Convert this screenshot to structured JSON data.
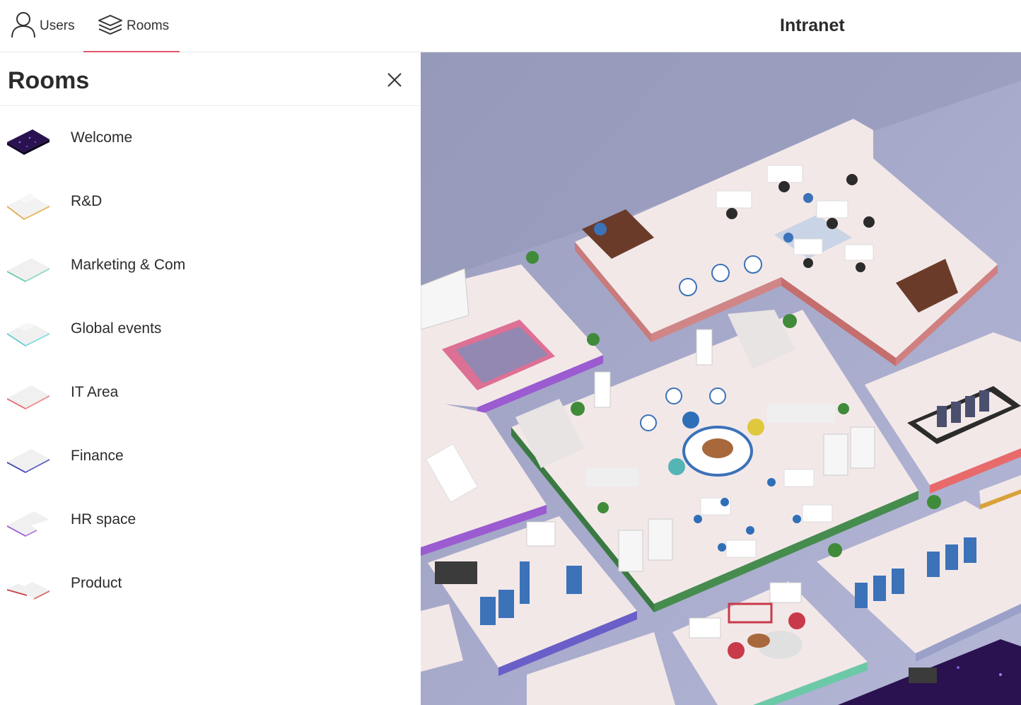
{
  "topbar": {
    "tabs": [
      {
        "label": "Users",
        "icon": "user-icon"
      },
      {
        "label": "Rooms",
        "icon": "layers-icon",
        "active": true
      }
    ],
    "title": "Intranet",
    "accent_color": "#e3566b"
  },
  "panel": {
    "title": "Rooms",
    "close_icon": "close-icon",
    "rooms": [
      {
        "name": "Welcome",
        "edge_color": "#1b0b3a"
      },
      {
        "name": "R&D",
        "edge_color": "#e0a23a"
      },
      {
        "name": "Marketing & Com",
        "edge_color": "#6cc9a8"
      },
      {
        "name": "Global events",
        "edge_color": "#5fc9d0"
      },
      {
        "name": "IT Area",
        "edge_color": "#e86a6a"
      },
      {
        "name": "Finance",
        "edge_color": "#3f3fb5"
      },
      {
        "name": "HR space",
        "edge_color": "#9b5bd1"
      },
      {
        "name": "Product",
        "edge_color": "#c84a4a"
      }
    ]
  },
  "map": {
    "background_color": "#a7abcb",
    "floor_color": "#f3e6e6"
  }
}
